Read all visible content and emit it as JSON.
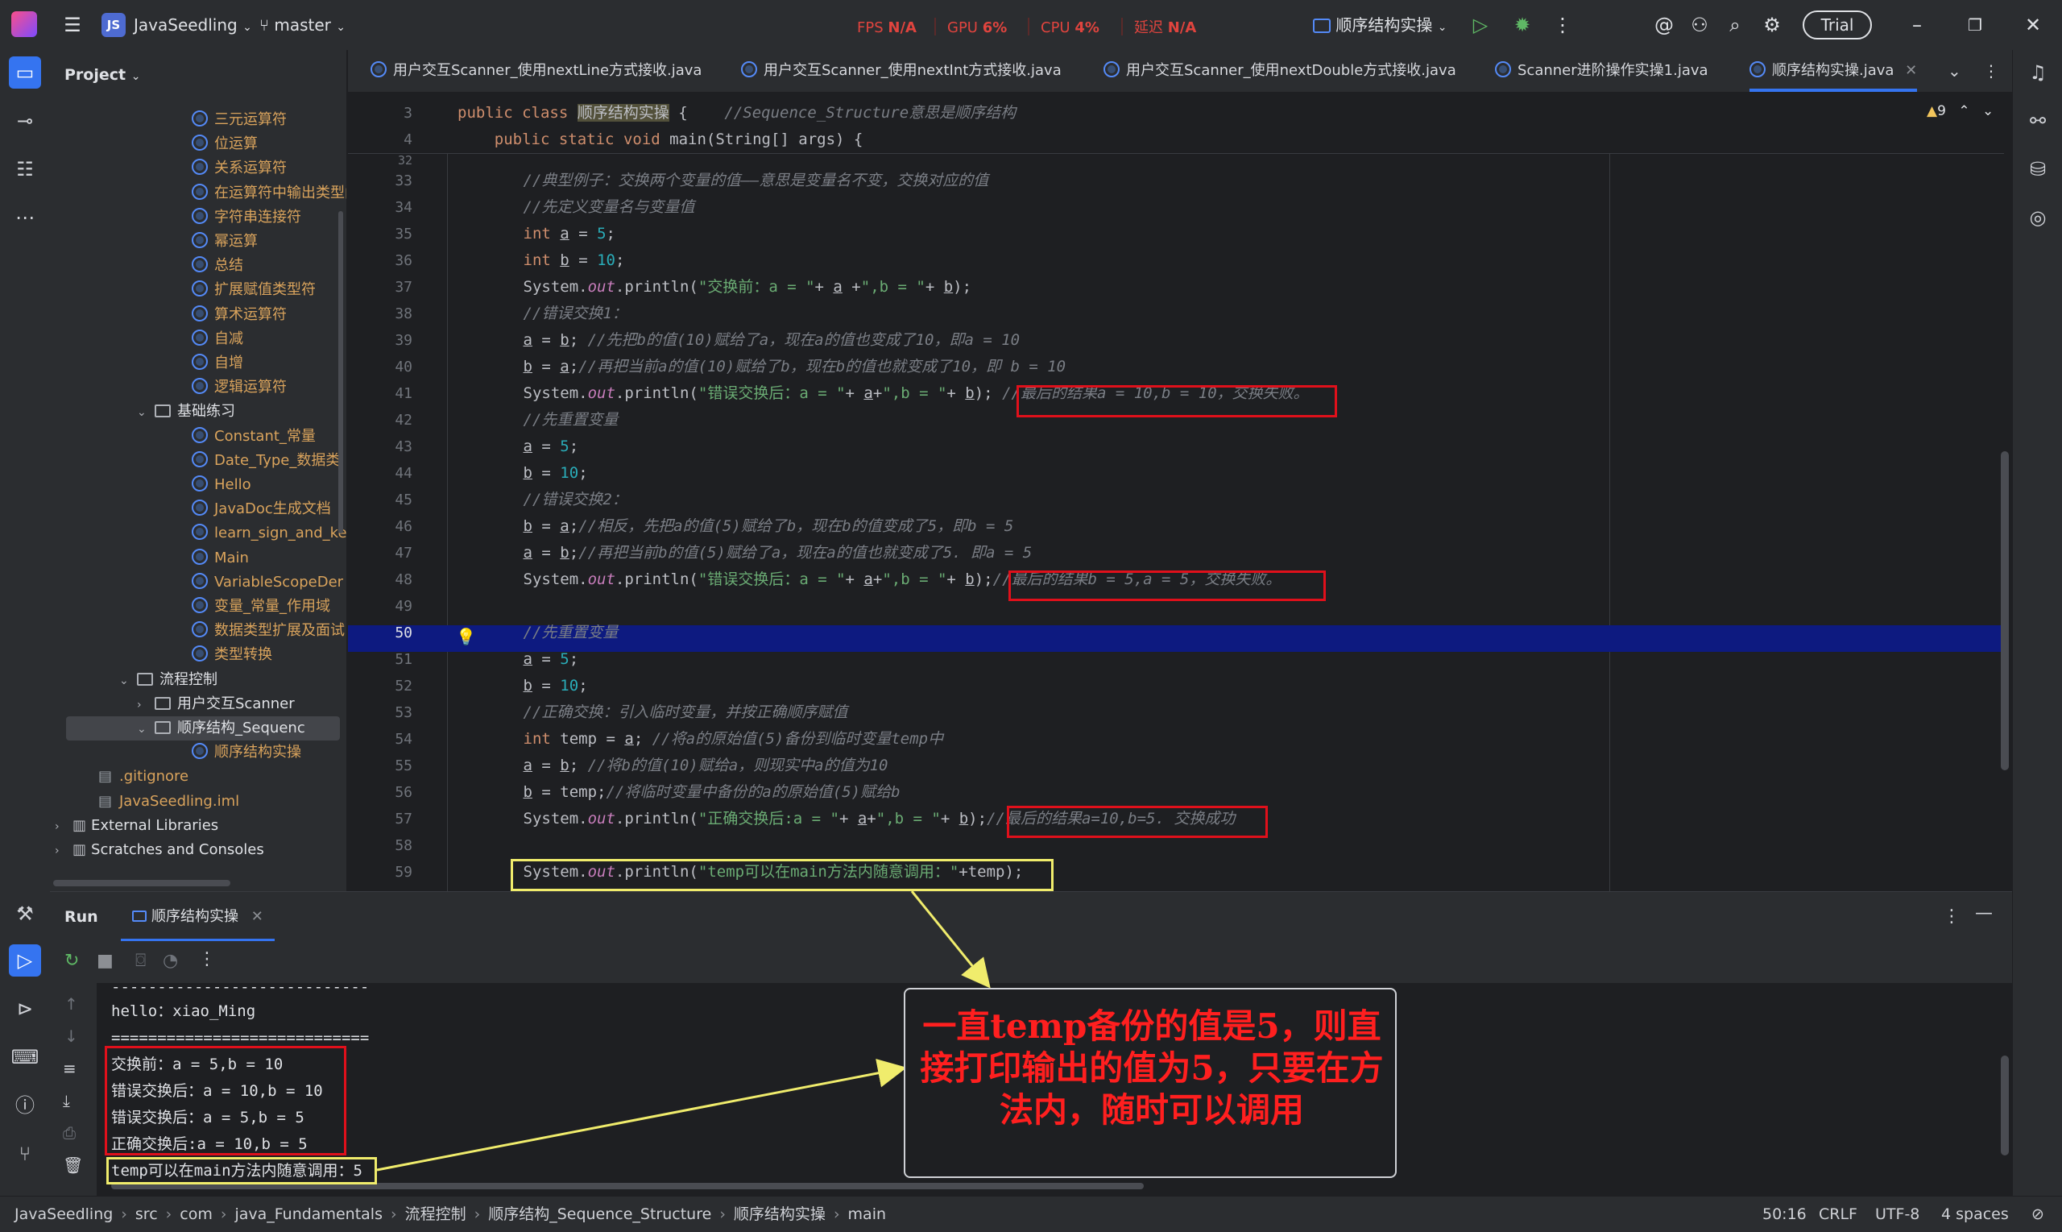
{
  "titlebar": {
    "project_name": "JavaSeedling",
    "project_badge": "JS",
    "branch": "master",
    "fps_label": "FPS",
    "fps_value": "N/A",
    "gpu_label": "GPU",
    "gpu_value": "6%",
    "cpu_label": "CPU",
    "cpu_value": "4%",
    "latency_label": "延迟",
    "latency_value": "N/A",
    "run_config": "顺序结构实操",
    "trial_label": "Trial"
  },
  "project_panel": {
    "title": "Project",
    "items": [
      {
        "label": "三元运算符",
        "kind": "class",
        "indent": 2
      },
      {
        "label": "位运算",
        "kind": "class",
        "indent": 2
      },
      {
        "label": "关系运算符",
        "kind": "class",
        "indent": 2
      },
      {
        "label": "在运算符中输出类型问",
        "kind": "class",
        "indent": 2
      },
      {
        "label": "字符串连接符",
        "kind": "class",
        "indent": 2
      },
      {
        "label": "幂运算",
        "kind": "class",
        "indent": 2
      },
      {
        "label": "总结",
        "kind": "class",
        "indent": 2
      },
      {
        "label": "扩展赋值类型符",
        "kind": "class",
        "indent": 2
      },
      {
        "label": "算术运算符",
        "kind": "class",
        "indent": 2
      },
      {
        "label": "自减",
        "kind": "class",
        "indent": 2
      },
      {
        "label": "自增",
        "kind": "class",
        "indent": 2
      },
      {
        "label": "逻辑运算符",
        "kind": "class",
        "indent": 2
      },
      {
        "label": "基础练习",
        "kind": "folder-open",
        "indent": 1
      },
      {
        "label": "Constant_常量",
        "kind": "class",
        "indent": 2
      },
      {
        "label": "Date_Type_数据类",
        "kind": "class",
        "indent": 2
      },
      {
        "label": "Hello",
        "kind": "class",
        "indent": 2
      },
      {
        "label": "JavaDoc生成文档",
        "kind": "class",
        "indent": 2
      },
      {
        "label": "learn_sign_and_ke",
        "kind": "class",
        "indent": 2
      },
      {
        "label": "Main",
        "kind": "class",
        "indent": 2
      },
      {
        "label": "VariableScopeDer",
        "kind": "class",
        "indent": 2
      },
      {
        "label": "变量_常量_作用域",
        "kind": "class",
        "indent": 2
      },
      {
        "label": "数据类型扩展及面试",
        "kind": "class",
        "indent": 2
      },
      {
        "label": "类型转换",
        "kind": "class",
        "indent": 2
      },
      {
        "label": "流程控制",
        "kind": "folder-open",
        "indent": 0
      },
      {
        "label": "用户交互Scanner",
        "kind": "folder-closed",
        "indent": 1
      },
      {
        "label": "顺序结构_Sequenc",
        "kind": "folder-open-selected",
        "indent": 1
      },
      {
        "label": "顺序结构实操",
        "kind": "class",
        "indent": 2
      },
      {
        "label": ".gitignore",
        "kind": "file",
        "indent": -1
      },
      {
        "label": "JavaSeedling.iml",
        "kind": "file",
        "indent": -1
      },
      {
        "label": "External Libraries",
        "kind": "lib",
        "indent": -2
      },
      {
        "label": "Scratches and Consoles",
        "kind": "lib",
        "indent": -2
      }
    ]
  },
  "tabs": [
    {
      "label": "用户交互Scanner_使用nextLine方式接收.java",
      "active": false
    },
    {
      "label": "用户交互Scanner_使用nextInt方式接收.java",
      "active": false
    },
    {
      "label": "用户交互Scanner_使用nextDouble方式接收.java",
      "active": false
    },
    {
      "label": "Scanner进阶操作实操1.java",
      "active": false
    },
    {
      "label": "顺序结构实操.java",
      "active": true
    }
  ],
  "editor": {
    "warning_count": "9",
    "sticky": [
      {
        "line": "3",
        "text": "public class 顺序结构实操 {    //Sequence_Structure意思是顺序结构"
      },
      {
        "line": "4",
        "text": "    public static void main(String[] args) {"
      }
    ],
    "lines": [
      {
        "n": "32",
        "code": ""
      },
      {
        "n": "33",
        "code": "        //典型例子：交换两个变量的值——意思是变量名不变，交换对应的值"
      },
      {
        "n": "34",
        "code": "        //先定义变量名与变量值"
      },
      {
        "n": "35",
        "code": "        int a = 5;"
      },
      {
        "n": "36",
        "code": "        int b = 10;"
      },
      {
        "n": "37",
        "code": "        System.out.println(\"交换前：a = \"+ a +\",b = \"+ b);"
      },
      {
        "n": "38",
        "code": "        //错误交换1："
      },
      {
        "n": "39",
        "code": "        a = b; //先把b的值(10)赋给了a，现在a的值也变成了10，即a = 10"
      },
      {
        "n": "40",
        "code": "        b = a;//再把当前a的值(10)赋给了b，现在b的值也就变成了10，即 b = 10"
      },
      {
        "n": "41",
        "code": "        System.out.println(\"错误交换后：a = \"+ a+\",b = \"+ b); //最后的结果a = 10,b = 10，交换失败。"
      },
      {
        "n": "42",
        "code": "        //先重置变量"
      },
      {
        "n": "43",
        "code": "        a = 5;"
      },
      {
        "n": "44",
        "code": "        b = 10;"
      },
      {
        "n": "45",
        "code": "        //错误交换2："
      },
      {
        "n": "46",
        "code": "        b = a;//相反，先把a的值(5)赋给了b，现在b的值变成了5，即b = 5"
      },
      {
        "n": "47",
        "code": "        a = b;//再把当前b的值(5)赋给了a，现在a的值也就变成了5. 即a = 5"
      },
      {
        "n": "48",
        "code": "        System.out.println(\"错误交换后：a = \"+ a+\",b = \"+ b);//最后的结果b = 5,a = 5，交换失败。"
      },
      {
        "n": "49",
        "code": ""
      },
      {
        "n": "50",
        "code": "        //先重置变量"
      },
      {
        "n": "51",
        "code": "        a = 5;"
      },
      {
        "n": "52",
        "code": "        b = 10;"
      },
      {
        "n": "53",
        "code": "        //正确交换：引入临时变量，并按正确顺序赋值"
      },
      {
        "n": "54",
        "code": "        int temp = a; //将a的原始值(5)备份到临时变量temp中"
      },
      {
        "n": "55",
        "code": "        a = b; //将b的值(10)赋给a，则现实中a的值为10"
      },
      {
        "n": "56",
        "code": "        b = temp;//将临时变量中备份的a的原始值(5)赋给b"
      },
      {
        "n": "57",
        "code": "        System.out.println(\"正确交换后:a = \"+ a+\",b = \"+ b);//最后的结果a=10,b=5. 交换成功"
      },
      {
        "n": "58",
        "code": ""
      },
      {
        "n": "59",
        "code": "        System.out.println(\"temp可以在main方法内随意调用：\"+temp);"
      }
    ]
  },
  "run_panel": {
    "title": "Run",
    "tab_label": "顺序结构实操",
    "output": [
      "----------------------------",
      "hello：xiao_Ming",
      "============================",
      "交换前：a = 5,b = 10",
      "错误交换后：a = 10,b = 10",
      "错误交换后：a = 5,b = 5",
      "正确交换后:a = 10,b = 5",
      "temp可以在main方法内随意调用：5"
    ]
  },
  "callout": {
    "text": "一直temp备份的值是5，则直接打印输出的值为5，只要在方法内，随时可以调用"
  },
  "statusbar": {
    "breadcrumbs": [
      "JavaSeedling",
      "src",
      "com",
      "java_Fundamentals",
      "流程控制",
      "顺序结构_Sequence_Structure",
      "顺序结构实操",
      "main"
    ],
    "position": "50:16",
    "line_sep": "CRLF",
    "encoding": "UTF-8",
    "indent": "4 spaces"
  },
  "colors": {
    "accent": "#3574f0",
    "annotation_red": "#e0101b",
    "annotation_yellow": "#f0ec6c",
    "current_line": "#0d1a80"
  }
}
